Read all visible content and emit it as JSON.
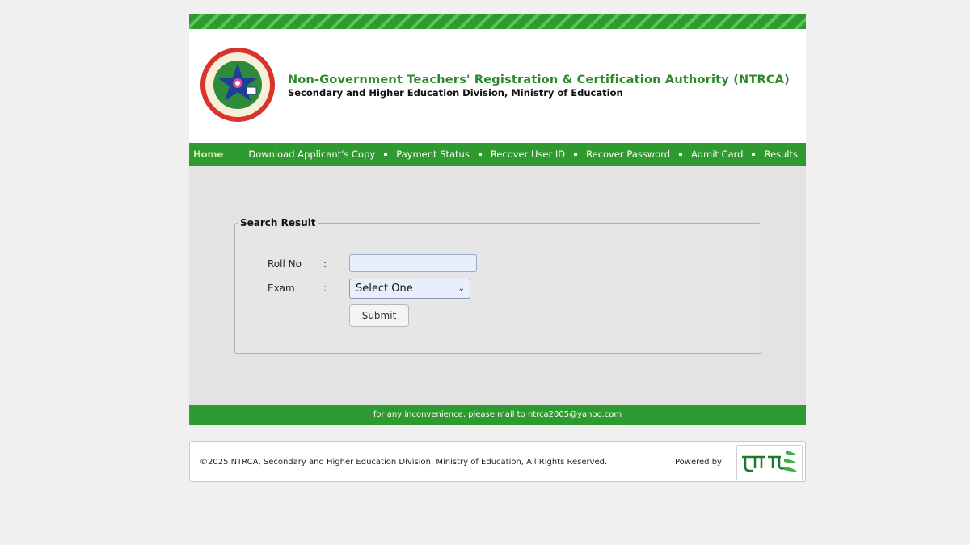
{
  "header": {
    "org_name": "Non-Government Teachers' Registration & Certification Authority (NTRCA)",
    "org_sub": "Secondary and Higher Education Division, Ministry of Education",
    "logo_icon": "ntrca-seal-logo"
  },
  "nav": {
    "home": "Home",
    "links": [
      "Download Applicant's Copy",
      "Payment Status",
      "Recover User ID",
      "Recover Password",
      "Admit Card",
      "Results"
    ]
  },
  "search": {
    "legend": "Search Result",
    "roll_label": "Roll No",
    "exam_label": "Exam",
    "colon": ":",
    "roll_value": "",
    "exam_selected": "Select One",
    "submit_label": "Submit"
  },
  "notice": "for any inconvenience, please mail to ntrca2005@yahoo.com",
  "footer": {
    "copyright": "©2025 NTRCA, Secondary and Higher Education Division, Ministry of Education, All Rights Reserved.",
    "powered_by": "Powered by",
    "vendor_logo_icon": "teletalk-logo"
  },
  "colors": {
    "brand_green": "#2f9a2f",
    "title_green": "#2a8a2a",
    "content_bg": "#e3e3e3"
  }
}
